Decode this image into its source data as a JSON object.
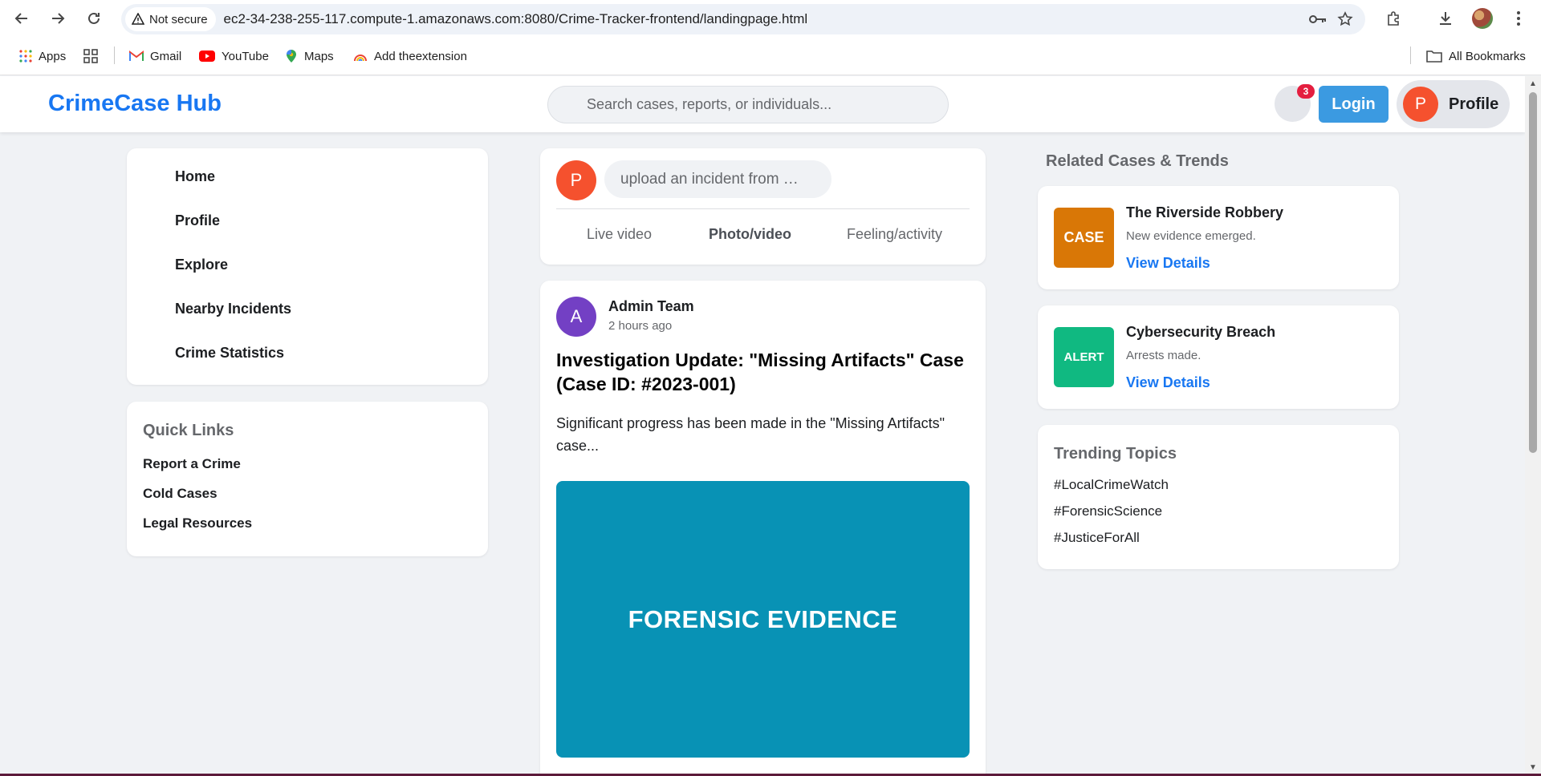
{
  "browser": {
    "security_label": "Not secure",
    "url": "ec2-34-238-255-117.compute-1.amazonaws.com:8080/Crime-Tracker-frontend/landingpage.html",
    "bookmarks": [
      {
        "label": "Apps",
        "icon": "apps-grid-icon"
      },
      {
        "label": "",
        "icon": "tab-groups-icon"
      },
      {
        "label": "Gmail",
        "icon": "gmail-icon"
      },
      {
        "label": "YouTube",
        "icon": "youtube-icon"
      },
      {
        "label": "Maps",
        "icon": "maps-icon"
      },
      {
        "label": "Add theextension",
        "icon": "rainbow-icon"
      }
    ],
    "all_bookmarks_label": "All Bookmarks"
  },
  "header": {
    "logo": "CrimeCase Hub",
    "search_placeholder": "Search cases, reports, or individuals...",
    "notification_count": "3",
    "login_label": "Login",
    "profile_initial": "P",
    "profile_label": "Profile"
  },
  "sidebar": {
    "menu": [
      {
        "label": "Home"
      },
      {
        "label": "Profile"
      },
      {
        "label": "Explore"
      },
      {
        "label": "Nearby Incidents"
      },
      {
        "label": "Crime Statistics"
      }
    ],
    "quick_links": {
      "title": "Quick Links",
      "items": [
        {
          "label": "Report a Crime"
        },
        {
          "label": "Cold Cases"
        },
        {
          "label": "Legal Resources"
        }
      ]
    }
  },
  "composer": {
    "avatar_initial": "P",
    "placeholder": "upload an incident from …",
    "actions": [
      {
        "label": "Live video"
      },
      {
        "label": "Photo/video"
      },
      {
        "label": "Feeling/activity"
      }
    ]
  },
  "post": {
    "avatar_initial": "A",
    "author": "Admin Team",
    "time": "2 hours ago",
    "title": "Investigation Update: \"Missing Artifacts\" Case (Case ID: #2023-001)",
    "body": "Significant progress has been made in the \"Missing Artifacts\" case...",
    "image_text": "FORENSIC EVIDENCE",
    "image_color": "#0892b5"
  },
  "related": {
    "heading": "Related Cases & Trends",
    "cases": [
      {
        "badge": "CASE",
        "badge_color": "#d97706",
        "title": "The Riverside Robbery",
        "subtitle": "New evidence emerged.",
        "link": "View Details"
      },
      {
        "badge": "ALERT",
        "badge_color": "#10b981",
        "title": "Cybersecurity Breach",
        "subtitle": "Arrests made.",
        "link": "View Details"
      }
    ]
  },
  "trending": {
    "title": "Trending Topics",
    "items": [
      {
        "label": "#LocalCrimeWatch"
      },
      {
        "label": "#ForensicScience"
      },
      {
        "label": "#JusticeForAll"
      }
    ]
  },
  "colors": {
    "brand": "#1877f2",
    "login_button": "#3b9ae1",
    "profile_avatar": "#f5512e",
    "admin_avatar": "#7340c4",
    "notification_badge": "#e41e3f"
  }
}
